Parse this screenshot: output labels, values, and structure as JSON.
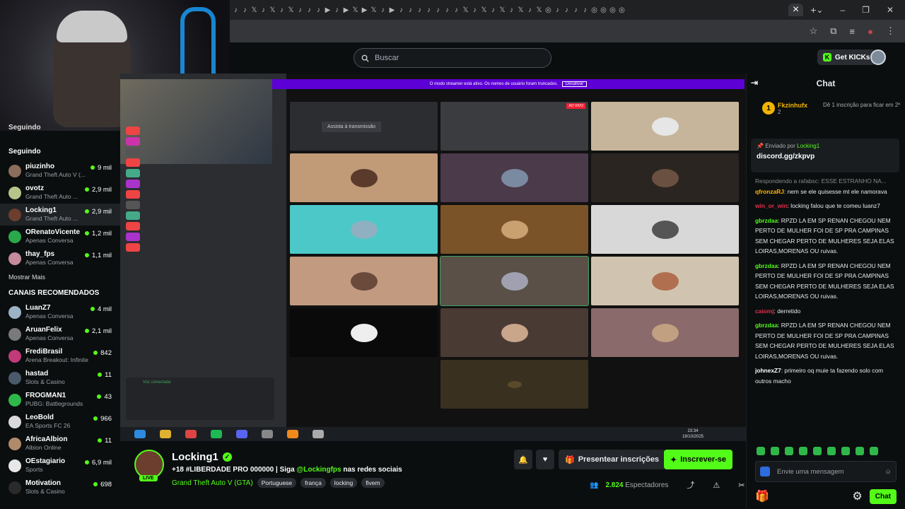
{
  "browser": {
    "tab_glyphs": [
      "♪",
      "♪",
      "𝕏",
      "♪",
      "𝕏",
      "♪",
      "𝕏",
      "♪",
      "♪",
      "♪",
      "▶",
      "♪",
      "▶",
      "𝕏",
      "▶",
      "𝕏",
      "♪",
      "▶",
      "♪",
      "♪",
      "♪",
      "♪",
      "♪",
      "♪",
      "♪",
      "𝕏",
      "♪",
      "𝕏",
      "♪",
      "𝕏",
      "♪",
      "𝕏",
      "♪",
      "𝕏",
      "◎",
      "♪",
      "♪",
      "♪",
      "♪",
      "◎",
      "◎",
      "◎",
      "◎"
    ],
    "active_tab_close": "×",
    "new_tab": "+",
    "window_controls": [
      "⌄",
      "–",
      "❐",
      "✕"
    ],
    "toolbar_icons": [
      "☆",
      "⧉",
      "≡",
      "●",
      "⋮"
    ]
  },
  "header": {
    "search_placeholder": "Buscar",
    "get_kicks": "Get KICKs"
  },
  "sidebar": {
    "following_top": "Seguindo",
    "following_label": "Seguindo",
    "following": [
      {
        "name": "piuzinho",
        "game": "Grand Theft Auto V (...",
        "viewers": "9 mil",
        "color": "#8a6d5b"
      },
      {
        "name": "ovotz",
        "game": "Grand Theft Auto ...",
        "viewers": "2,9 mil",
        "color": "#b9c48a"
      },
      {
        "name": "Locking1",
        "game": "Grand Theft Auto ...",
        "viewers": "2,9 mil",
        "color": "#6b3e2e"
      },
      {
        "name": "ORenatoVicente",
        "game": "Apenas Conversa",
        "viewers": "1,2 mil",
        "color": "#2aa84a"
      },
      {
        "name": "thay_fps",
        "game": "Apenas Conversa",
        "viewers": "1,1 mil",
        "color": "#c58b9a"
      }
    ],
    "show_more": "Mostrar Mais",
    "recommended_label": "CANAIS RECOMENDADOS",
    "recommended": [
      {
        "name": "LuanZ7",
        "game": "Apenas Conversa",
        "viewers": "4 mil",
        "color": "#9bb3c5"
      },
      {
        "name": "AruanFelix",
        "game": "Apenas Conversa",
        "viewers": "2,1 mil",
        "color": "#7a7a7a"
      },
      {
        "name": "FrediBrasil",
        "game": "Arena Breakout: Infinite",
        "viewers": "842",
        "color": "#c13a7a"
      },
      {
        "name": "hastad",
        "game": "Slots & Casino",
        "viewers": "11",
        "color": "#4a5a6a"
      },
      {
        "name": "FROGMAN1",
        "game": "PUBG: Battlegrounds",
        "viewers": "43",
        "color": "#2fb84a"
      },
      {
        "name": "LeoBold",
        "game": "EA Sports FC 26",
        "viewers": "966",
        "color": "#d9d9d9"
      },
      {
        "name": "AfricaAlbion",
        "game": "Albion Online",
        "viewers": "11",
        "color": "#b08a6a"
      },
      {
        "name": "OEstagiario",
        "game": "Sports",
        "viewers": "6,9 mil",
        "color": "#e7e7e7"
      },
      {
        "name": "Motivation",
        "game": "Slots & Casino",
        "viewers": "698",
        "color": "#2a2a2a"
      }
    ]
  },
  "stream_content": {
    "banner": "O modo streamer está ativo. Os nomes de usuário foram truncados.",
    "banner_button": "Desativar",
    "watch_label": "Assista à transmissão",
    "live_badge": "AO VIVO",
    "voice_status": "Voz conectada",
    "taskbar_time": "23:34",
    "taskbar_date": "19/10/2025"
  },
  "stream_info": {
    "streamer": "Locking1",
    "live": "LIVE",
    "title_prefix": "+18 #LIBERDADE PRO 000000 | Siga ",
    "title_handle": "@Lockingfps",
    "title_suffix": " nas redes sociais",
    "category": "Grand Theft Auto V (GTA)",
    "tags": [
      "Portuguese",
      "frança",
      "locking",
      "fivem"
    ],
    "gift_label": "Presentear inscrições",
    "subscribe_label": "Inscrever-se",
    "viewers_count": "2.824",
    "viewers_label": "Espectadores"
  },
  "chat": {
    "title": "Chat",
    "subgoal_user": "Fkzinhufx",
    "subgoal_count": "2",
    "subgoal_rank": "1",
    "subgoal_text": "Dê 1 inscrição para ficar em 2º",
    "pinned_by_label": "Enviado por",
    "pinned_by": "Locking1",
    "pinned_text": "discord.gg/zkpvp",
    "messages": [
      {
        "reply": "Respondendo a rafabsc: ESSE ESTRANHO NA...",
        "user": "qfronzaRJ",
        "color": "#ffb300",
        "text": "nem se ele quisesse mt ele namorava"
      },
      {
        "user": "win_or_win",
        "color": "#e0304a",
        "text": "locking falou que te comeu luanz7"
      },
      {
        "user": "gbrzdaa",
        "color": "#53fc18",
        "text": "RPZD LA EM SP RENAN CHEGOU NEM PERTO DE MULHER FOI DE SP PRA CAMPINAS SEM CHEGAR PERTO DE MULHERES SEJA ELAS LOIRAS,MORENAS OU ruivas."
      },
      {
        "user": "gbrzdaa",
        "color": "#53fc18",
        "text": "RPZD LA EM SP RENAN CHEGOU NEM PERTO DE MULHER FOI DE SP PRA CAMPINAS SEM CHEGAR PERTO DE MULHERES SEJA ELAS LOIRAS,MORENAS OU ruivas."
      },
      {
        "user": "caiomj",
        "color": "#e0304a",
        "text": "derretido"
      },
      {
        "user": "gbrzdaa",
        "color": "#53fc18",
        "text": "RPZD LA EM SP RENAN CHEGOU NEM PERTO DE MULHER FOI DE SP PRA CAMPINAS SEM CHEGAR PERTO DE MULHERES SEJA ELAS LOIRAS,MORENAS OU ruivas."
      },
      {
        "user": "johnexZ7",
        "color": "#ffffff",
        "text": "primeiro oq muie ta fazendo solo com outros macho"
      }
    ],
    "input_placeholder": "Envie uma mensagem",
    "send_label": "Chat"
  }
}
